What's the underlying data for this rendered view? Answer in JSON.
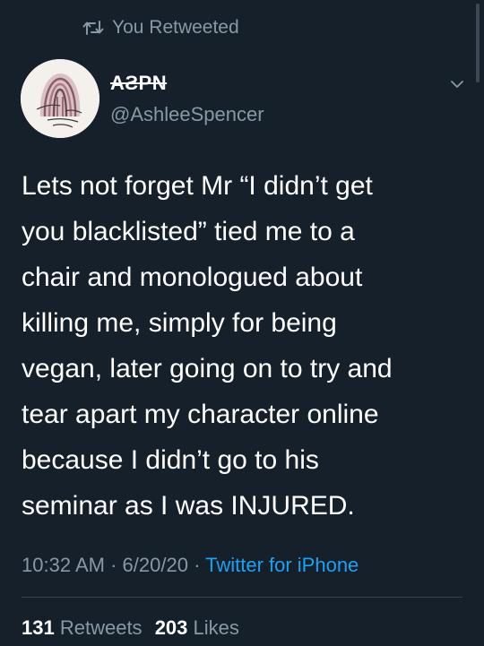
{
  "retweet_banner": {
    "label": "You Retweeted",
    "icon": "retweet-icon"
  },
  "tweet": {
    "author": {
      "display_name": "AƧPN",
      "handle": "@AshleeSpencer",
      "avatar_icon": "avatar-image"
    },
    "text": "Lets not forget Mr “I didn’t get\nyou blacklisted” tied me to a\nchair and monologued about\nkilling me, simply for being\nvegan, later going on to try and\ntear apart my character online\nbecause I didn’t go to his\nseminar as I was INJURED.",
    "time": "10:32 AM",
    "date": "6/20/20",
    "separator": "·",
    "source": "Twitter for iPhone",
    "retweets_count": "131",
    "retweets_label": "Retweets",
    "likes_count": "203",
    "likes_label": "Likes"
  },
  "colors": {
    "background": "#15202b",
    "primary_text": "#ffffff",
    "secondary_text": "#8899a6",
    "link": "#1da1f2",
    "divider": "#38444d"
  }
}
